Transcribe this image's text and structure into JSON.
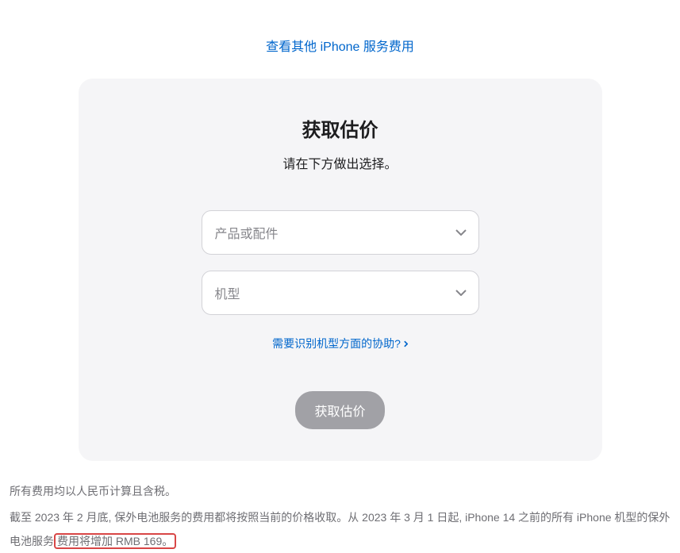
{
  "top_link": {
    "label": "查看其他 iPhone 服务费用"
  },
  "card": {
    "title": "获取估价",
    "subtitle": "请在下方做出选择。",
    "select_product_placeholder": "产品或配件",
    "select_model_placeholder": "机型",
    "help_link_label": "需要识别机型方面的协助?",
    "submit_label": "获取估价"
  },
  "footer": {
    "line1": "所有费用均以人民币计算且含税。",
    "line2_pre": "截至 2023 年 2 月底, 保外电池服务的费用都将按照当前的价格收取。从 2023 年 3 月 1 日起, iPhone 14 之前的所有 iPhone 机型的保外电池服务",
    "line2_highlight": "费用将增加 RMB 169。"
  }
}
